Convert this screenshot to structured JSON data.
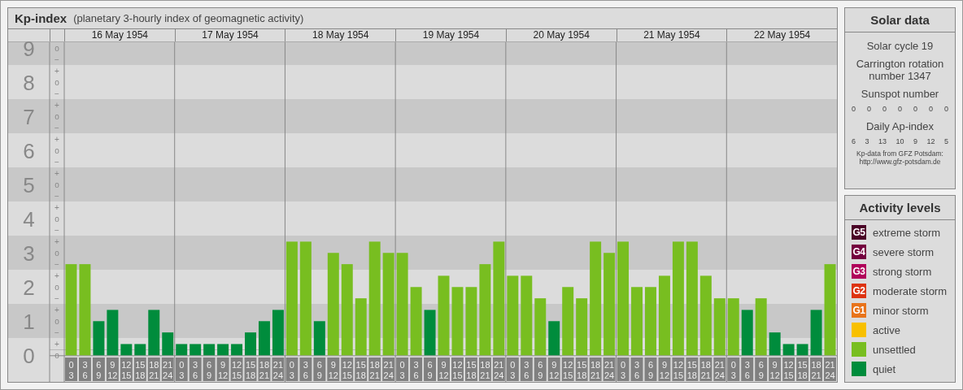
{
  "kp_panel": {
    "title": "Kp-index",
    "subtitle": "(planetary 3-hourly index of geomagnetic activity)",
    "sublevel_marks": [
      "o",
      "−",
      "+",
      "o",
      "−",
      "+",
      "o",
      "−",
      "+",
      "o",
      "−",
      "+",
      "o",
      "−",
      "+",
      "o",
      "−",
      "+",
      "o",
      "−",
      "+",
      "o",
      "−",
      "+",
      "o",
      "−",
      "+",
      "o"
    ],
    "dates": [
      "16 May 1954",
      "17 May 1954",
      "18 May 1954",
      "19 May 1954",
      "20 May 1954",
      "21 May 1954",
      "22 May 1954"
    ],
    "chart_data": {
      "type": "bar",
      "stacked": true,
      "ylim": [
        0,
        9.17
      ],
      "categories": [
        "0\n3",
        "3\n6",
        "6\n9",
        "9\n12",
        "12\n15",
        "15\n18",
        "18\n21",
        "21\n24",
        "0\n3",
        "3\n6",
        "6\n9",
        "9\n12",
        "12\n15",
        "15\n18",
        "18\n21",
        "21\n24",
        "0\n3",
        "3\n6",
        "6\n9",
        "9\n12",
        "12\n15",
        "15\n18",
        "18\n21",
        "21\n24",
        "0\n3",
        "3\n6",
        "6\n9",
        "9\n12",
        "12\n15",
        "15\n18",
        "18\n21",
        "21\n24",
        "0\n3",
        "3\n6",
        "6\n9",
        "9\n12",
        "12\n15",
        "15\n18",
        "18\n21",
        "21\n24",
        "0\n3",
        "3\n6",
        "6\n9",
        "9\n12",
        "12\n15",
        "15\n18",
        "18\n21",
        "21\n24",
        "0\n3",
        "3\n6",
        "6\n9",
        "9\n12",
        "12\n15",
        "15\n18",
        "18\n21",
        "21\n24"
      ],
      "series": [
        {
          "color": "#008c3c",
          "values": [
            null,
            null,
            1,
            1.33,
            0.33,
            0.33,
            1.33,
            0.67,
            0.33,
            0.33,
            0.33,
            0.33,
            0.33,
            0.67,
            1,
            1.33,
            null,
            null,
            1,
            null,
            null,
            null,
            null,
            null,
            null,
            null,
            1.33,
            null,
            null,
            null,
            null,
            null,
            null,
            null,
            null,
            1,
            null,
            null,
            null,
            null,
            null,
            null,
            null,
            null,
            null,
            null,
            null,
            null,
            null,
            1.33,
            null,
            0.67,
            0.33,
            0.33,
            1.33,
            null
          ]
        },
        {
          "color": "#78be20",
          "values": [
            2.67,
            2.67,
            null,
            null,
            null,
            null,
            null,
            null,
            null,
            null,
            null,
            null,
            null,
            null,
            null,
            null,
            3.33,
            3.33,
            null,
            3,
            2.67,
            1.67,
            3.33,
            3,
            3,
            2,
            null,
            2.33,
            2,
            2,
            2.67,
            3.33,
            2.33,
            2.33,
            1.67,
            null,
            2,
            1.67,
            3.33,
            3,
            3.33,
            2,
            2,
            2.33,
            3.33,
            3.33,
            2.33,
            1.67,
            1.67,
            null,
            1.67,
            null,
            null,
            null,
            null,
            2.67
          ]
        }
      ],
      "yticks": [
        {
          "value": 0,
          "label": "0"
        },
        {
          "value": 1,
          "label": "1"
        },
        {
          "value": 2,
          "label": "2"
        },
        {
          "value": 3,
          "label": "3"
        },
        {
          "value": 4,
          "label": "4"
        },
        {
          "value": 5,
          "label": "5"
        },
        {
          "value": 6,
          "label": "6"
        },
        {
          "value": 7,
          "label": "7"
        },
        {
          "value": 8,
          "label": "8"
        },
        {
          "value": 9,
          "label": "9"
        }
      ],
      "grid": true
    }
  },
  "solar_data": {
    "title": "Solar data",
    "solar_cycle": "Solar cycle 19",
    "carrington": "Carrington rotation number 1347",
    "sunspot_label": "Sunspot number",
    "sunspot_numbers": [
      "0",
      "0",
      "0",
      "0",
      "0",
      "0",
      "0"
    ],
    "ap_label": "Daily Ap-index",
    "ap_values": [
      "6",
      "3",
      "13",
      "10",
      "9",
      "12",
      "5"
    ],
    "credit_lines": [
      "Kp-data from GFZ Potsdam:",
      "http://www.gfz-potsdam.de"
    ]
  },
  "activity_levels": {
    "title": "Activity levels",
    "items": [
      {
        "badge": "G5",
        "label": "extreme storm",
        "color": "#4a0026"
      },
      {
        "badge": "G4",
        "label": "severe storm",
        "color": "#74003e"
      },
      {
        "badge": "G3",
        "label": "strong storm",
        "color": "#b0005a"
      },
      {
        "badge": "G2",
        "label": "moderate storm",
        "color": "#dd3311"
      },
      {
        "badge": "G1",
        "label": "minor storm",
        "color": "#e8731a"
      },
      {
        "label": "active",
        "color": "#f8c000"
      },
      {
        "label": "unsettled",
        "color": "#78be20"
      },
      {
        "label": "quiet",
        "color": "#008c3c"
      }
    ]
  }
}
